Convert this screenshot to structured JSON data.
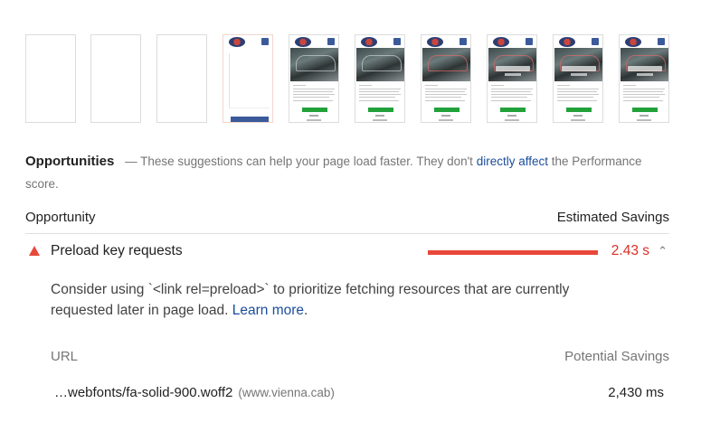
{
  "filmstrip": {
    "frames": [
      "blank",
      "blank",
      "blank",
      "partial",
      "full",
      "full",
      "full",
      "full",
      "full",
      "full"
    ]
  },
  "opportunities": {
    "title": "Opportunities",
    "separator": "—",
    "text_before": "These suggestions can help your page load faster. They don't ",
    "link": "directly affect",
    "text_after": " the Performance score."
  },
  "columns": {
    "left": "Opportunity",
    "right": "Estimated Savings"
  },
  "audit": {
    "icon": "warning-triangle-icon",
    "title": "Preload key requests",
    "savings": "2.43 s",
    "chevron": "⌃",
    "desc_before": "Consider using `<link rel=preload>` to prioritize fetching resources that are currently requested later in page load. ",
    "learn_more": "Learn more",
    "desc_after": ".",
    "color": "#e8483a"
  },
  "table": {
    "col_url": "URL",
    "col_savings": "Potential Savings",
    "rows": [
      {
        "url": "…webfonts/fa-solid-900.woff2",
        "host": "(www.vienna.cab)",
        "savings": "2,430 ms"
      }
    ]
  }
}
